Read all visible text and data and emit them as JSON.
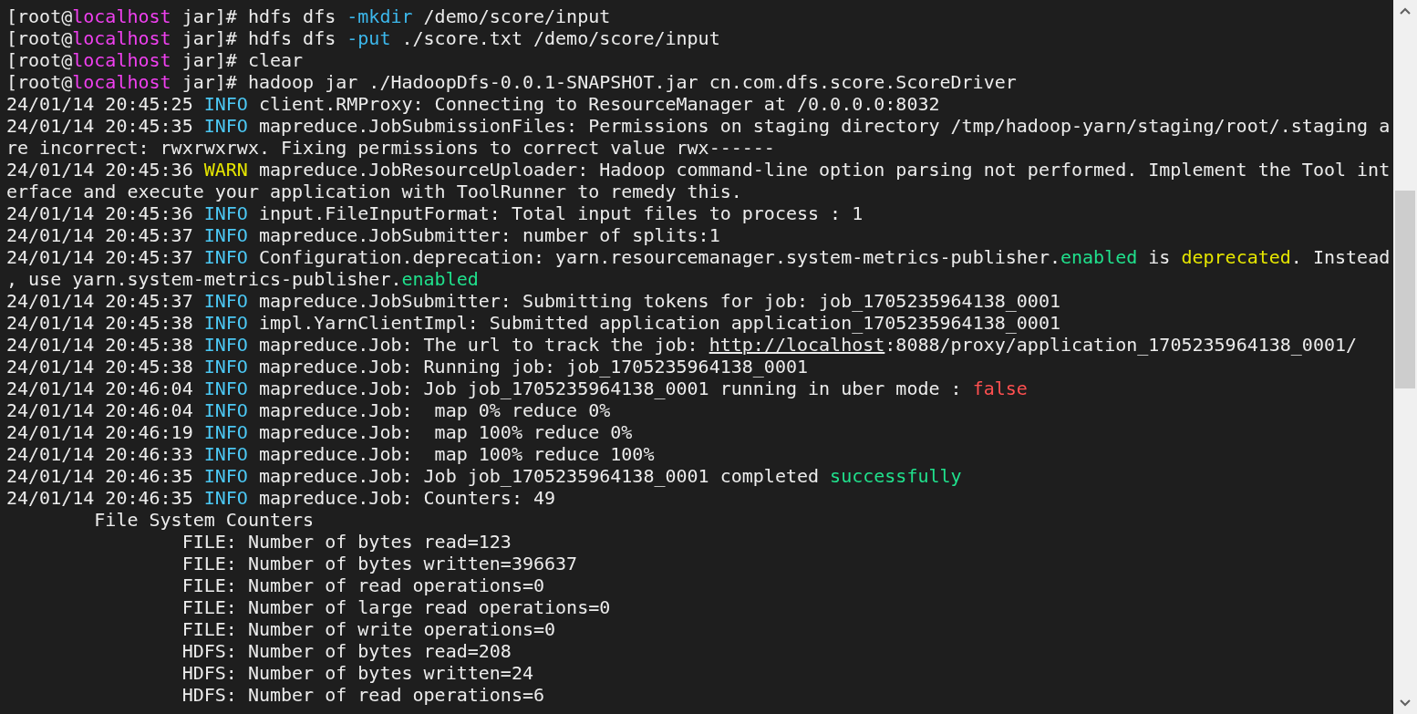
{
  "terminal": {
    "lines": [
      {
        "segments": [
          {
            "kind": "plain",
            "text": "[root@"
          },
          {
            "kind": "host",
            "text": "localhost"
          },
          {
            "kind": "plain",
            "text": " jar]# hdfs dfs "
          },
          {
            "kind": "option",
            "text": "-mkdir"
          },
          {
            "kind": "plain",
            "text": " /demo/score/input"
          }
        ]
      },
      {
        "segments": [
          {
            "kind": "plain",
            "text": "[root@"
          },
          {
            "kind": "host",
            "text": "localhost"
          },
          {
            "kind": "plain",
            "text": " jar]# hdfs dfs "
          },
          {
            "kind": "option",
            "text": "-put"
          },
          {
            "kind": "plain",
            "text": " ./score.txt /demo/score/input"
          }
        ]
      },
      {
        "segments": [
          {
            "kind": "plain",
            "text": "[root@"
          },
          {
            "kind": "host",
            "text": "localhost"
          },
          {
            "kind": "plain",
            "text": " jar]# clear"
          }
        ]
      },
      {
        "segments": [
          {
            "kind": "plain",
            "text": "[root@"
          },
          {
            "kind": "host",
            "text": "localhost"
          },
          {
            "kind": "plain",
            "text": " jar]# hadoop jar ./HadoopDfs-0.0.1-SNAPSHOT.jar cn.com.dfs.score.ScoreDriver"
          }
        ]
      },
      {
        "segments": [
          {
            "kind": "plain",
            "text": "24/01/14 20:45:25 "
          },
          {
            "kind": "info",
            "text": "INFO"
          },
          {
            "kind": "plain",
            "text": " client.RMProxy: Connecting to ResourceManager at /0.0.0.0:8032"
          }
        ]
      },
      {
        "segments": [
          {
            "kind": "plain",
            "text": "24/01/14 20:45:35 "
          },
          {
            "kind": "info",
            "text": "INFO"
          },
          {
            "kind": "plain",
            "text": " mapreduce.JobSubmissionFiles: Permissions on staging directory /tmp/hadoop-yarn/staging/root/.staging a"
          }
        ]
      },
      {
        "segments": [
          {
            "kind": "plain",
            "text": "re incorrect: rwxrwxrwx. Fixing permissions to correct value rwx------"
          }
        ]
      },
      {
        "segments": [
          {
            "kind": "plain",
            "text": "24/01/14 20:45:36 "
          },
          {
            "kind": "warn",
            "text": "WARN"
          },
          {
            "kind": "plain",
            "text": " mapreduce.JobResourceUploader: Hadoop command-line option parsing not performed. Implement the Tool int"
          }
        ]
      },
      {
        "segments": [
          {
            "kind": "plain",
            "text": "erface and execute your application with ToolRunner to remedy this."
          }
        ]
      },
      {
        "segments": [
          {
            "kind": "plain",
            "text": "24/01/14 20:45:36 "
          },
          {
            "kind": "info",
            "text": "INFO"
          },
          {
            "kind": "plain",
            "text": " input.FileInputFormat: Total input files to process : 1"
          }
        ]
      },
      {
        "segments": [
          {
            "kind": "plain",
            "text": "24/01/14 20:45:37 "
          },
          {
            "kind": "info",
            "text": "INFO"
          },
          {
            "kind": "plain",
            "text": " mapreduce.JobSubmitter: number of splits:1"
          }
        ]
      },
      {
        "segments": [
          {
            "kind": "plain",
            "text": "24/01/14 20:45:37 "
          },
          {
            "kind": "info",
            "text": "INFO"
          },
          {
            "kind": "plain",
            "text": " Configuration.deprecation: yarn.resourcemanager.system-metrics-publisher."
          },
          {
            "kind": "good",
            "text": "enabled"
          },
          {
            "kind": "plain",
            "text": " is "
          },
          {
            "kind": "warn",
            "text": "deprecated"
          },
          {
            "kind": "plain",
            "text": ". Instead"
          }
        ]
      },
      {
        "segments": [
          {
            "kind": "plain",
            "text": ", use yarn.system-metrics-publisher."
          },
          {
            "kind": "good",
            "text": "enabled"
          }
        ]
      },
      {
        "segments": [
          {
            "kind": "plain",
            "text": "24/01/14 20:45:37 "
          },
          {
            "kind": "info",
            "text": "INFO"
          },
          {
            "kind": "plain",
            "text": " mapreduce.JobSubmitter: Submitting tokens for job: job_1705235964138_0001"
          }
        ]
      },
      {
        "segments": [
          {
            "kind": "plain",
            "text": "24/01/14 20:45:38 "
          },
          {
            "kind": "info",
            "text": "INFO"
          },
          {
            "kind": "plain",
            "text": " impl.YarnClientImpl: Submitted application application_1705235964138_0001"
          }
        ]
      },
      {
        "segments": [
          {
            "kind": "plain",
            "text": "24/01/14 20:45:38 "
          },
          {
            "kind": "info",
            "text": "INFO"
          },
          {
            "kind": "plain",
            "text": " mapreduce.Job: The url to track the job: "
          },
          {
            "kind": "link",
            "text": "http://localhost"
          },
          {
            "kind": "plain",
            "text": ":8088/proxy/application_1705235964138_0001/"
          }
        ]
      },
      {
        "segments": [
          {
            "kind": "plain",
            "text": "24/01/14 20:45:38 "
          },
          {
            "kind": "info",
            "text": "INFO"
          },
          {
            "kind": "plain",
            "text": " mapreduce.Job: Running job: job_1705235964138_0001"
          }
        ]
      },
      {
        "segments": [
          {
            "kind": "plain",
            "text": "24/01/14 20:46:04 "
          },
          {
            "kind": "info",
            "text": "INFO"
          },
          {
            "kind": "plain",
            "text": " mapreduce.Job: Job job_1705235964138_0001 running in uber mode : "
          },
          {
            "kind": "bad",
            "text": "false"
          }
        ]
      },
      {
        "segments": [
          {
            "kind": "plain",
            "text": "24/01/14 20:46:04 "
          },
          {
            "kind": "info",
            "text": "INFO"
          },
          {
            "kind": "plain",
            "text": " mapreduce.Job:  map 0% reduce 0%"
          }
        ]
      },
      {
        "segments": [
          {
            "kind": "plain",
            "text": "24/01/14 20:46:19 "
          },
          {
            "kind": "info",
            "text": "INFO"
          },
          {
            "kind": "plain",
            "text": " mapreduce.Job:  map 100% reduce 0%"
          }
        ]
      },
      {
        "segments": [
          {
            "kind": "plain",
            "text": "24/01/14 20:46:33 "
          },
          {
            "kind": "info",
            "text": "INFO"
          },
          {
            "kind": "plain",
            "text": " mapreduce.Job:  map 100% reduce 100%"
          }
        ]
      },
      {
        "segments": [
          {
            "kind": "plain",
            "text": "24/01/14 20:46:35 "
          },
          {
            "kind": "info",
            "text": "INFO"
          },
          {
            "kind": "plain",
            "text": " mapreduce.Job: Job job_1705235964138_0001 completed "
          },
          {
            "kind": "good",
            "text": "successfully"
          }
        ]
      },
      {
        "segments": [
          {
            "kind": "plain",
            "text": "24/01/14 20:46:35 "
          },
          {
            "kind": "info",
            "text": "INFO"
          },
          {
            "kind": "plain",
            "text": " mapreduce.Job: Counters: 49"
          }
        ]
      },
      {
        "segments": [
          {
            "kind": "plain",
            "text": "        File System Counters"
          }
        ]
      },
      {
        "segments": [
          {
            "kind": "plain",
            "text": "                FILE: Number of bytes read=123"
          }
        ]
      },
      {
        "segments": [
          {
            "kind": "plain",
            "text": "                FILE: Number of bytes written=396637"
          }
        ]
      },
      {
        "segments": [
          {
            "kind": "plain",
            "text": "                FILE: Number of read operations=0"
          }
        ]
      },
      {
        "segments": [
          {
            "kind": "plain",
            "text": "                FILE: Number of large read operations=0"
          }
        ]
      },
      {
        "segments": [
          {
            "kind": "plain",
            "text": "                FILE: Number of write operations=0"
          }
        ]
      },
      {
        "segments": [
          {
            "kind": "plain",
            "text": "                HDFS: Number of bytes read=208"
          }
        ]
      },
      {
        "segments": [
          {
            "kind": "plain",
            "text": "                HDFS: Number of bytes written=24"
          }
        ]
      },
      {
        "segments": [
          {
            "kind": "plain",
            "text": "                HDFS: Number of read operations=6"
          }
        ]
      }
    ]
  }
}
